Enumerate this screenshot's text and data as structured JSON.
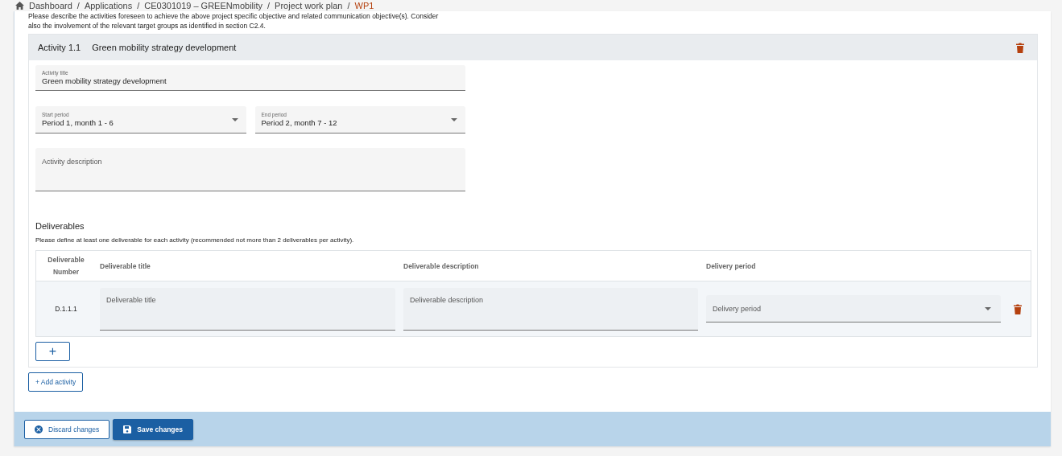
{
  "breadcrumb_separator": "/",
  "breadcrumb": [
    {
      "label": "Dashboard",
      "current": false
    },
    {
      "label": "Applications",
      "current": false
    },
    {
      "label": "CE0301019 – GREENmobility",
      "current": false
    },
    {
      "label": "Project work plan",
      "current": false
    },
    {
      "label": "WP1",
      "current": true
    }
  ],
  "intro": "Please describe the activities foreseen to achieve the above project specific objective and related communication objective(s). Consider also the involvement of the relevant target groups as identified in section C2.4.",
  "activity": {
    "number": "Activity 1.1",
    "title": "Green mobility strategy development",
    "title_field": {
      "label": "Activity title",
      "value": "Green mobility strategy development"
    },
    "start_period": {
      "label": "Start period",
      "value": "Period 1, month 1 - 6"
    },
    "end_period": {
      "label": "End period",
      "value": "Period 2, month 7 - 12"
    },
    "description": {
      "placeholder": "Activity description"
    },
    "deliverables": {
      "heading": "Deliverables",
      "hint": "Please define at least one deliverable for each activity (recommended not more than 2 deliverables per activity).",
      "columns": [
        "Deliverable Number",
        "Deliverable title",
        "Deliverable description",
        "Delivery period"
      ],
      "rows": [
        {
          "number": "D.1.1.1",
          "title_placeholder": "Deliverable title",
          "description_placeholder": "Deliverable description",
          "period_placeholder": "Delivery period"
        }
      ],
      "add_button": "+"
    }
  },
  "add_activity": "+ Add activity",
  "footer_buttons": [
    {
      "label": "Discard changes",
      "kind": "secondary"
    },
    {
      "label": "Save changes",
      "kind": "primary"
    }
  ]
}
